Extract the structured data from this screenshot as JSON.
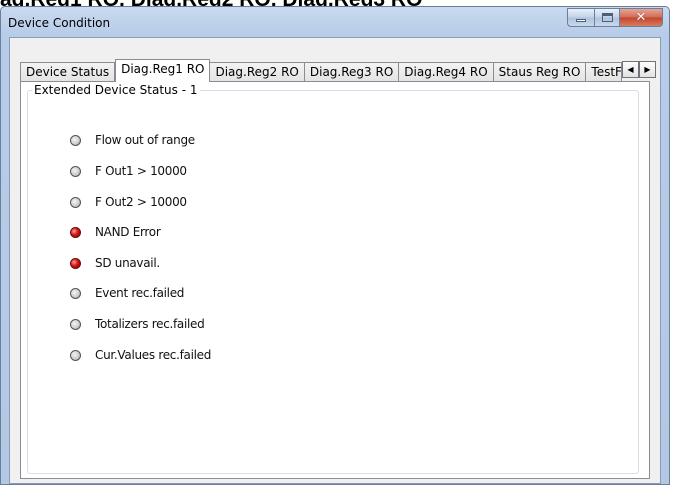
{
  "header_crop": "ag.Reg1 RO, Diag.Reg2 RO, Diag.Reg3 RO",
  "window": {
    "title": "Device Condition"
  },
  "tabs": [
    {
      "label": "Device Status",
      "active": false
    },
    {
      "label": "Diag.Reg1 RO",
      "active": true
    },
    {
      "label": "Diag.Reg2 RO",
      "active": false
    },
    {
      "label": "Diag.Reg3 RO",
      "active": false
    },
    {
      "label": "Diag.Reg4 RO",
      "active": false
    },
    {
      "label": "Staus Reg RO",
      "active": false
    },
    {
      "label": "TestFu",
      "active": false
    }
  ],
  "group": {
    "label": "Extended Device Status - 1"
  },
  "status_items": [
    {
      "label": "Flow out of range",
      "state": "off"
    },
    {
      "label": "F Out1 > 10000",
      "state": "off"
    },
    {
      "label": "F Out2 > 10000",
      "state": "off"
    },
    {
      "label": "NAND Error",
      "state": "on"
    },
    {
      "label": "SD unavail.",
      "state": "on"
    },
    {
      "label": "Event rec.failed",
      "state": "off"
    },
    {
      "label": "Totalizers rec.failed",
      "state": "off"
    },
    {
      "label": "Cur.Values rec.failed",
      "state": "off"
    }
  ],
  "colors": {
    "led_on": "#d41414",
    "led_off": "#cfcfcf"
  },
  "icons": {
    "minimize": "minimize-icon",
    "maximize": "maximize-icon",
    "close": "close-icon",
    "scroll_left": "arrow-left-icon",
    "scroll_right": "arrow-right-icon"
  }
}
